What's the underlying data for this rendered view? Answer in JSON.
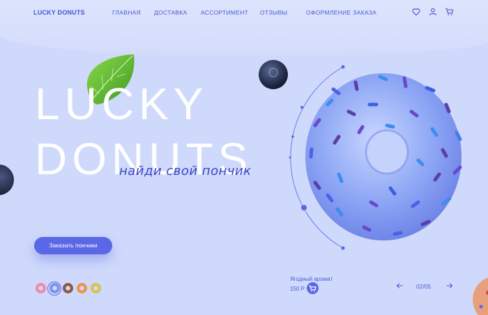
{
  "header": {
    "logo": "LUCKY DONUTS",
    "nav": [
      "ГЛАВНАЯ",
      "ДОСТАВКА",
      "АССОРТИМЕНТ",
      "ОТЗЫВЫ",
      "ОФОРМЛЕНИЕ ЗАКАЗА"
    ],
    "icons": [
      "heart-icon",
      "user-icon",
      "cart-icon"
    ]
  },
  "hero": {
    "title_line1": "LUCKY",
    "title_line2": "DONUTS",
    "tagline": "найди свой пончик",
    "cta_label": "Заказать пончики"
  },
  "flavors": {
    "thumbnails": [
      "pink-donut-thumb",
      "blue-donut-thumb",
      "chocolate-donut-thumb",
      "orange-donut-thumb",
      "yellow-donut-thumb"
    ],
    "selected_index": 1
  },
  "product": {
    "name": "Ягодный аромат",
    "price": "150 Р"
  },
  "pager": {
    "current": "02/05"
  },
  "colors": {
    "background": "#cfd9fb",
    "accent": "#5a67e6",
    "text": "#4a57d6",
    "hero_text": "#ffffff"
  }
}
